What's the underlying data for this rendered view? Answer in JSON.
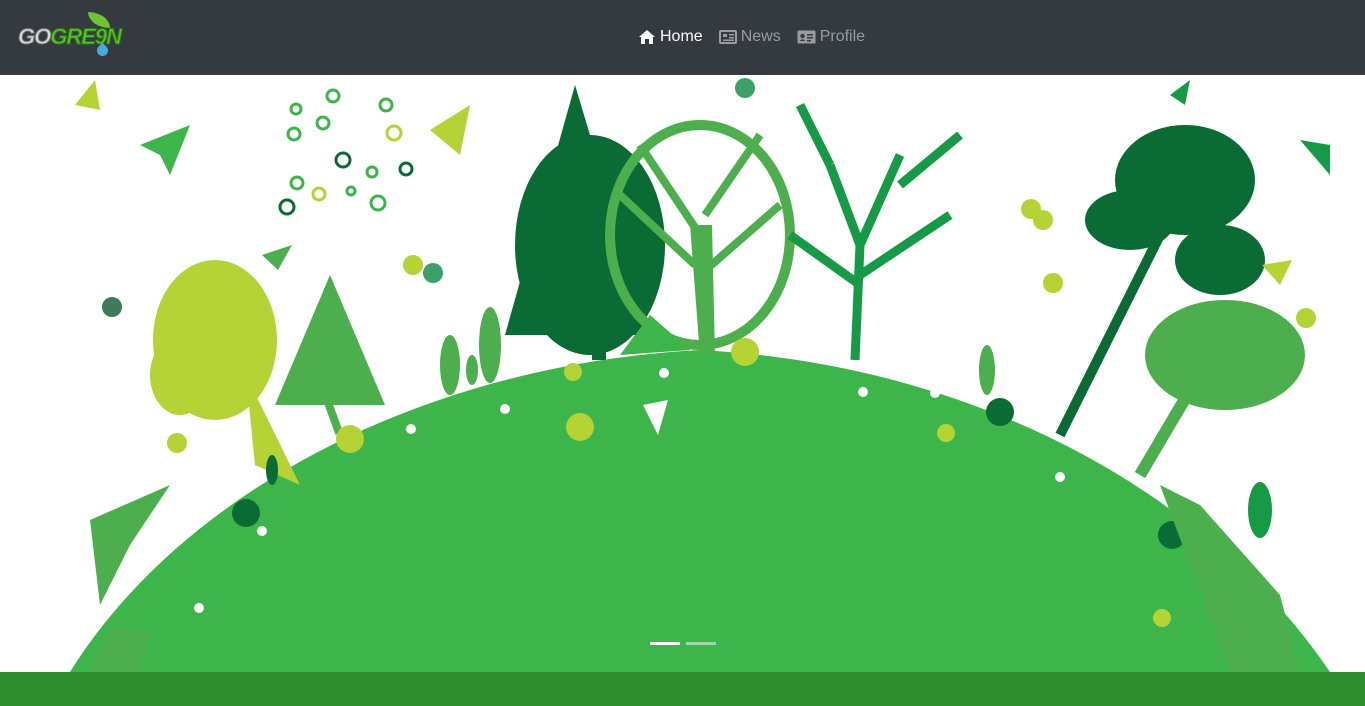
{
  "brand": {
    "logo_text_a": "GO",
    "logo_text_b": "GRE9N",
    "logo_icon": "leaf-drop-icon"
  },
  "nav": {
    "items": [
      {
        "label": "Home",
        "icon": "home-icon",
        "active": true
      },
      {
        "label": "News",
        "icon": "newspaper-icon",
        "active": false
      },
      {
        "label": "Profile",
        "icon": "id-card-icon",
        "active": false
      }
    ]
  },
  "carousel": {
    "slide_count": 2,
    "active_index": 0
  },
  "colors": {
    "navbar": "#343a40",
    "hill": "#3db54a",
    "dark_green": "#0b6b34",
    "lime": "#b5d334",
    "footer_band": "#2e8b2e"
  }
}
